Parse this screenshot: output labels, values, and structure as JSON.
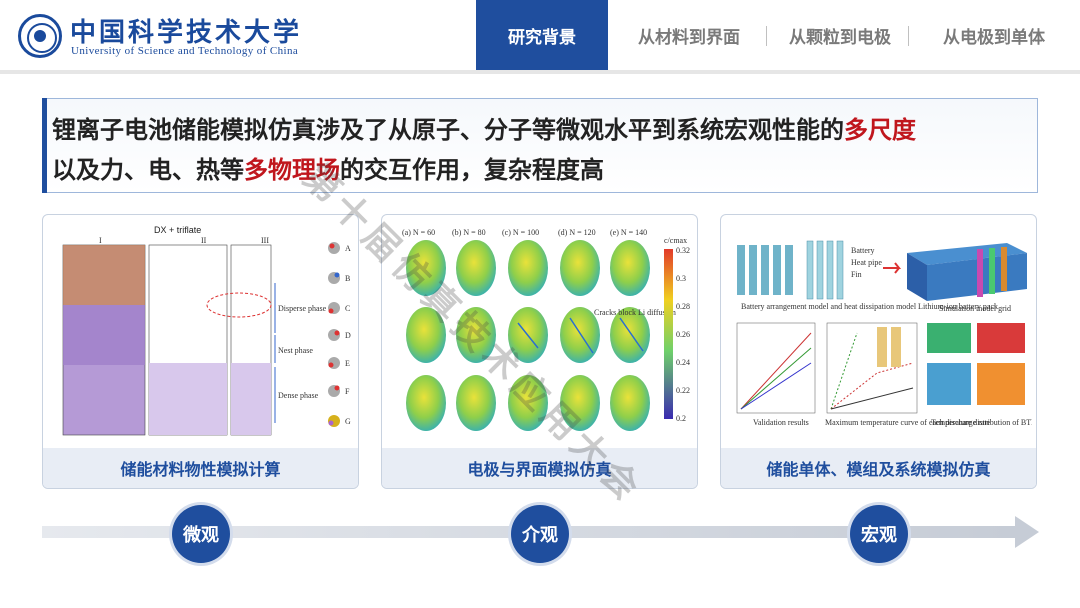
{
  "header": {
    "logo_cn": "中国科学技术大学",
    "logo_en": "University of Science and Technology of China",
    "tabs": [
      {
        "label": "研究背景",
        "active": true
      },
      {
        "label": "从材料到界面",
        "active": false
      },
      {
        "label": "从颗粒到电极",
        "active": false
      },
      {
        "label": "从电极到单体",
        "active": false
      }
    ]
  },
  "headline": {
    "line1_prefix": "锂离子电池储能模拟仿真涉及了从原子、分子等微观水平到系统宏观性能的",
    "line1_highlight": "多尺度",
    "line2_prefix": "以及力、电、热等",
    "line2_highlight": "多物理场",
    "line2_suffix": "的交互作用，复杂程度高",
    "highlight_color": "#c0161d"
  },
  "panels": [
    {
      "caption": "储能材料物性模拟计算",
      "figure_title": "DX + triflate",
      "column_labels": [
        "I",
        "II",
        "III"
      ],
      "phase_labels": [
        "Disperse phase",
        "Nest phase",
        "Dense phase"
      ],
      "molecule_labels": [
        "A",
        "B",
        "C",
        "D",
        "E",
        "F",
        "G"
      ]
    },
    {
      "caption": "电极与界面模拟仿真",
      "col_labels": [
        "(a) N = 60",
        "(b) N = 80",
        "(c) N = 100",
        "(d) N = 120",
        "(e) N = 140"
      ],
      "colorbar_title": "c/cmax",
      "colorbar_ticks": [
        "0.32",
        "0.3",
        "0.28",
        "0.26",
        "0.24",
        "0.22",
        "0.2"
      ],
      "annotation": "Cracks block Li diffusion"
    },
    {
      "caption": "储能单体、模组及系统模拟仿真",
      "legend_items": [
        "Battery",
        "Heat pipe",
        "Fin"
      ],
      "sub_captions": [
        "Battery arrangement model and heat dissipation model Lithium-ion battery pack",
        "Simulation model grid"
      ],
      "chart_captions": [
        "Validation results",
        "Maximum temperature curve of each discharge rate",
        "Temperature distribution of BTMS"
      ]
    }
  ],
  "scale": {
    "labels": [
      "微观",
      "介观",
      "宏观"
    ],
    "color": "#1f4e9e"
  },
  "watermark": "第十届仿真技术应用大会"
}
